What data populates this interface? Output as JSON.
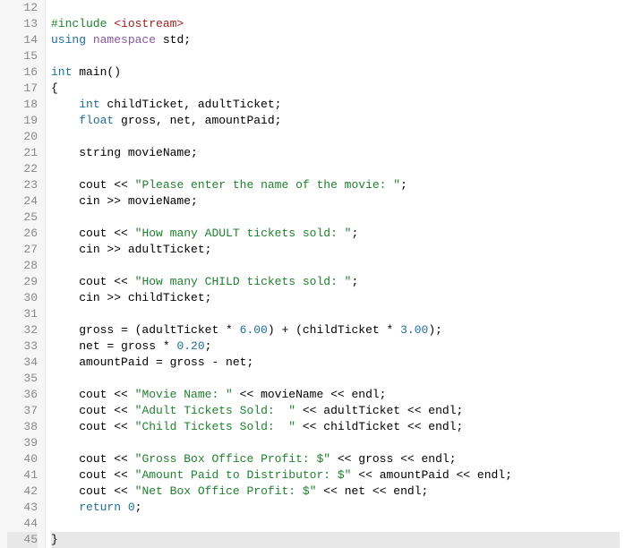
{
  "gutter": {
    "line_numbers": [
      "12",
      "13",
      "14",
      "15",
      "16",
      "17",
      "18",
      "19",
      "20",
      "21",
      "22",
      "23",
      "24",
      "25",
      "26",
      "27",
      "28",
      "29",
      "30",
      "31",
      "32",
      "33",
      "34",
      "35",
      "36",
      "37",
      "38",
      "39",
      "40",
      "41",
      "42",
      "43",
      "44",
      "45"
    ]
  },
  "code": {
    "lines": [
      {
        "n": "12",
        "segments": []
      },
      {
        "n": "13",
        "indent": "",
        "segments": [
          {
            "cls": "pre",
            "t": "#include "
          },
          {
            "cls": "angle",
            "t": "<iostream>"
          }
        ]
      },
      {
        "n": "14",
        "indent": "",
        "segments": [
          {
            "cls": "kw",
            "t": "using"
          },
          {
            "cls": "ident",
            "t": " "
          },
          {
            "cls": "ns",
            "t": "namespace"
          },
          {
            "cls": "ident",
            "t": " std;"
          }
        ]
      },
      {
        "n": "15",
        "segments": []
      },
      {
        "n": "16",
        "indent": "",
        "segments": [
          {
            "cls": "kw",
            "t": "int"
          },
          {
            "cls": "ident",
            "t": " main()"
          }
        ]
      },
      {
        "n": "17",
        "indent": "",
        "segments": [
          {
            "cls": "ident",
            "t": "{"
          }
        ]
      },
      {
        "n": "18",
        "indent": "    ",
        "segments": [
          {
            "cls": "kw",
            "t": "int"
          },
          {
            "cls": "ident",
            "t": " childTicket, adultTicket;"
          }
        ]
      },
      {
        "n": "19",
        "indent": "    ",
        "segments": [
          {
            "cls": "kw",
            "t": "float"
          },
          {
            "cls": "ident",
            "t": " gross, net, amountPaid;"
          }
        ]
      },
      {
        "n": "20",
        "segments": []
      },
      {
        "n": "21",
        "indent": "    ",
        "segments": [
          {
            "cls": "ident",
            "t": "string movieName;"
          }
        ]
      },
      {
        "n": "22",
        "segments": []
      },
      {
        "n": "23",
        "indent": "    ",
        "segments": [
          {
            "cls": "ident",
            "t": "cout << "
          },
          {
            "cls": "str",
            "t": "\"Please enter the name of the movie: \""
          },
          {
            "cls": "ident",
            "t": ";"
          }
        ]
      },
      {
        "n": "24",
        "indent": "    ",
        "segments": [
          {
            "cls": "ident",
            "t": "cin >> movieName;"
          }
        ]
      },
      {
        "n": "25",
        "segments": []
      },
      {
        "n": "26",
        "indent": "    ",
        "segments": [
          {
            "cls": "ident",
            "t": "cout << "
          },
          {
            "cls": "str",
            "t": "\"How many ADULT tickets sold: \""
          },
          {
            "cls": "ident",
            "t": ";"
          }
        ]
      },
      {
        "n": "27",
        "indent": "    ",
        "segments": [
          {
            "cls": "ident",
            "t": "cin >> adultTicket;"
          }
        ]
      },
      {
        "n": "28",
        "segments": []
      },
      {
        "n": "29",
        "indent": "    ",
        "segments": [
          {
            "cls": "ident",
            "t": "cout << "
          },
          {
            "cls": "str",
            "t": "\"How many CHILD tickets sold: \""
          },
          {
            "cls": "ident",
            "t": ";"
          }
        ]
      },
      {
        "n": "30",
        "indent": "    ",
        "segments": [
          {
            "cls": "ident",
            "t": "cin >> childTicket;"
          }
        ]
      },
      {
        "n": "31",
        "segments": []
      },
      {
        "n": "32",
        "indent": "    ",
        "segments": [
          {
            "cls": "ident",
            "t": "gross = (adultTicket * "
          },
          {
            "cls": "num",
            "t": "6.00"
          },
          {
            "cls": "ident",
            "t": ") + (childTicket * "
          },
          {
            "cls": "num",
            "t": "3.00"
          },
          {
            "cls": "ident",
            "t": ");"
          }
        ]
      },
      {
        "n": "33",
        "indent": "    ",
        "segments": [
          {
            "cls": "ident",
            "t": "net = gross * "
          },
          {
            "cls": "num",
            "t": "0.20"
          },
          {
            "cls": "ident",
            "t": ";"
          }
        ]
      },
      {
        "n": "34",
        "indent": "    ",
        "segments": [
          {
            "cls": "ident",
            "t": "amountPaid = gross - net;"
          }
        ]
      },
      {
        "n": "35",
        "segments": []
      },
      {
        "n": "36",
        "indent": "    ",
        "segments": [
          {
            "cls": "ident",
            "t": "cout << "
          },
          {
            "cls": "str",
            "t": "\"Movie Name: \""
          },
          {
            "cls": "ident",
            "t": " << movieName << endl;"
          }
        ]
      },
      {
        "n": "37",
        "indent": "    ",
        "segments": [
          {
            "cls": "ident",
            "t": "cout << "
          },
          {
            "cls": "str",
            "t": "\"Adult Tickets Sold:  \""
          },
          {
            "cls": "ident",
            "t": " << adultTicket << endl;"
          }
        ]
      },
      {
        "n": "38",
        "indent": "    ",
        "segments": [
          {
            "cls": "ident",
            "t": "cout << "
          },
          {
            "cls": "str",
            "t": "\"Child Tickets Sold:  \""
          },
          {
            "cls": "ident",
            "t": " << childTicket << endl;"
          }
        ]
      },
      {
        "n": "39",
        "segments": []
      },
      {
        "n": "40",
        "indent": "    ",
        "segments": [
          {
            "cls": "ident",
            "t": "cout << "
          },
          {
            "cls": "str",
            "t": "\"Gross Box Office Profit: $\""
          },
          {
            "cls": "ident",
            "t": " << gross << endl;"
          }
        ]
      },
      {
        "n": "41",
        "indent": "    ",
        "segments": [
          {
            "cls": "ident",
            "t": "cout << "
          },
          {
            "cls": "str",
            "t": "\"Amount Paid to Distributor: $\""
          },
          {
            "cls": "ident",
            "t": " << amountPaid << endl;"
          }
        ]
      },
      {
        "n": "42",
        "indent": "    ",
        "segments": [
          {
            "cls": "ident",
            "t": "cout << "
          },
          {
            "cls": "str",
            "t": "\"Net Box Office Profit: $\""
          },
          {
            "cls": "ident",
            "t": " << net << endl;"
          }
        ]
      },
      {
        "n": "43",
        "indent": "    ",
        "segments": [
          {
            "cls": "kw",
            "t": "return"
          },
          {
            "cls": "ident",
            "t": " "
          },
          {
            "cls": "num",
            "t": "0"
          },
          {
            "cls": "ident",
            "t": ";"
          }
        ]
      },
      {
        "n": "44",
        "segments": []
      },
      {
        "n": "45",
        "indent": "",
        "segments": [
          {
            "cls": "ident",
            "t": "}"
          }
        ],
        "highlight": true
      }
    ]
  }
}
